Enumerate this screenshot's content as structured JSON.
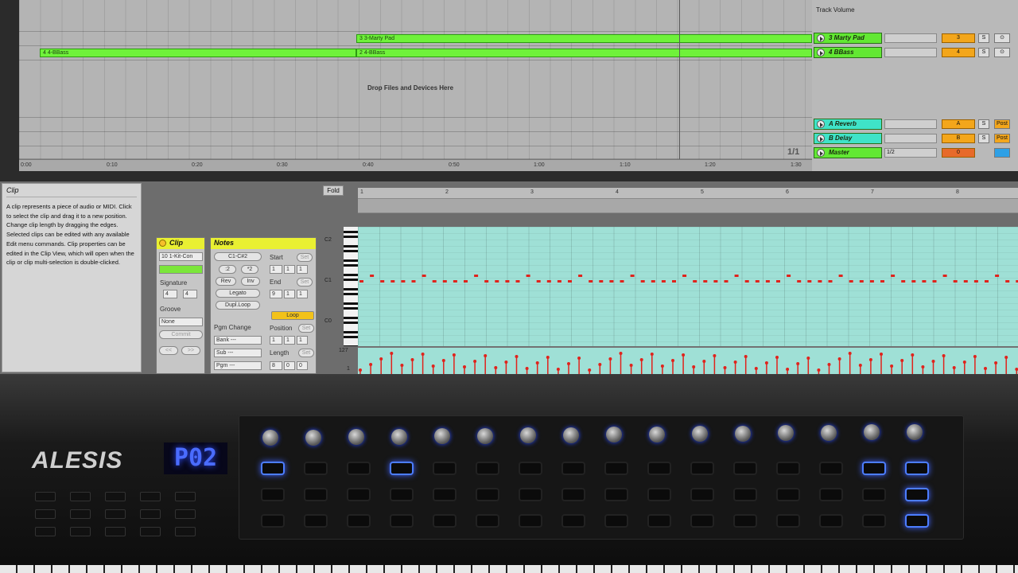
{
  "arrangement": {
    "drop_hint": "Drop Files and Devices Here",
    "clips": [
      {
        "label": "3 3-Marty Pad"
      },
      {
        "label": "4 4-BBass"
      },
      {
        "label": "2 4-BBass"
      }
    ],
    "time_ticks": [
      "0:00",
      "0:10",
      "0:20",
      "0:30",
      "0:40",
      "0:50",
      "1:00",
      "1:10",
      "1:20",
      "1:30"
    ],
    "mixer_label": "Track Volume",
    "page_indicator": "1/1",
    "tracks": [
      {
        "name": "3 Marty Pad",
        "num": "3",
        "s": "S",
        "r": "⊙",
        "color": "#62e833"
      },
      {
        "name": "4 BBass",
        "num": "4",
        "s": "S",
        "r": "⊙",
        "color": "#62e833"
      },
      {
        "name": "A Reverb",
        "num": "A",
        "s": "S",
        "r": "Post",
        "color": "#3fe3c8"
      },
      {
        "name": "B Delay",
        "num": "B",
        "s": "S",
        "r": "Post",
        "color": "#3fe3c8"
      },
      {
        "name": "Master",
        "num": "0",
        "s": "",
        "r": "",
        "vol": "1/2",
        "color": "#62e833"
      }
    ]
  },
  "info": {
    "title": "Clip",
    "body": "A clip represents a piece of audio or MIDI. Click to select the clip and drag it to a new position. Change clip length by dragging the edges. Selected clips can be edited with any available Edit menu commands. Clip properties can be edited in the Clip View, which will open when the clip or clip multi-selection is double-clicked."
  },
  "clip_panel": {
    "title": "Clip",
    "name": "10 1-Kit-Con",
    "signature_label": "Signature",
    "sig_num": "4",
    "sig_den": "4",
    "groove_label": "Groove",
    "groove_value": "None",
    "commit": "Commit",
    "back": "<<",
    "fwd": ">>"
  },
  "notes_panel": {
    "title": "Notes",
    "range": "C1-C#2",
    "half": ":2",
    "double": "*2",
    "rev": "Rev",
    "inv": "Inv",
    "legato": "Legato",
    "dupl": "Dupl.Loop",
    "pgm_change": "Pgm Change",
    "bank": "Bank ---",
    "sub": "Sub ---",
    "pgm": "Pgm ---",
    "start_label": "Start",
    "end_label": "End",
    "set": "Set",
    "loop": "Loop",
    "position_label": "Position",
    "length_label": "Length",
    "start": [
      "1",
      "1",
      "1"
    ],
    "end": [
      "9",
      "1",
      "1"
    ],
    "position": [
      "1",
      "1",
      "1"
    ],
    "length": [
      "8",
      "0",
      "0"
    ]
  },
  "editor": {
    "fold": "Fold",
    "bars": [
      "1",
      "2",
      "3",
      "4",
      "5",
      "6",
      "7",
      "8"
    ],
    "key_labels": [
      "C2",
      "C1",
      "C0"
    ],
    "vel_max": "127",
    "vel_min": "1"
  },
  "hardware": {
    "brand": "ALESIS",
    "display": "P02"
  }
}
